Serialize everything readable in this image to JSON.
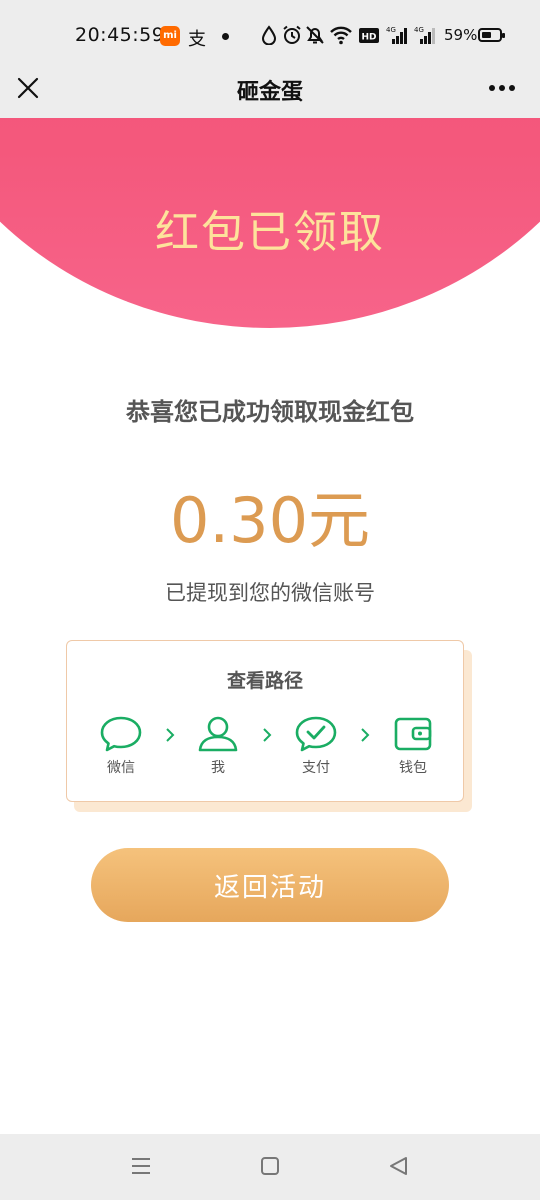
{
  "status_bar": {
    "time": "20:45:59",
    "mi_badge": "mi",
    "alipay_glyph": "支",
    "battery_text": "59%",
    "battery_level": 0.59
  },
  "nav": {
    "title": "砸金蛋",
    "close_icon": "close-icon",
    "more_icon": "more-icon"
  },
  "banner": {
    "title": "红包已领取"
  },
  "main": {
    "congrats": "恭喜您已成功领取现金红包",
    "amount": "0.30元",
    "withdrawn": "已提现到您的微信账号"
  },
  "path_card": {
    "title": "查看路径",
    "steps": [
      {
        "label": "微信",
        "icon": "wechat-icon"
      },
      {
        "label": "我",
        "icon": "user-icon"
      },
      {
        "label": "支付",
        "icon": "pay-icon"
      },
      {
        "label": "钱包",
        "icon": "wallet-icon"
      }
    ]
  },
  "actions": {
    "return_label": "返回活动"
  },
  "colors": {
    "banner": "#f4587c",
    "banner_title": "#fde39b",
    "amount": "#dc9b52",
    "path_green": "#1aad63",
    "button_top": "#f5c27c",
    "button_bottom": "#e6a75c"
  }
}
